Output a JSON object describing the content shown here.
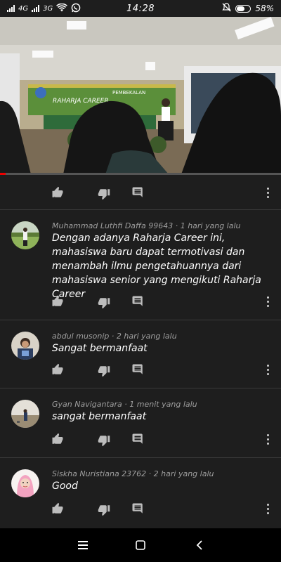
{
  "status_bar": {
    "net1": "4G",
    "net1_suffix": "ıl",
    "net2": "3G",
    "time": "14:28",
    "battery": "58%"
  },
  "video": {
    "banner_top": "PEMBEKALAN",
    "banner_name": "RAHARJA CAREER",
    "progress": 0.02
  },
  "video_actions": {
    "like_icon": "thumb-up-icon",
    "dislike_icon": "thumb-down-icon",
    "reply_icon": "comment-icon",
    "more_icon": "more-vert-icon"
  },
  "comments": [
    {
      "author": "Muhammad Luthfi Daffa 99643",
      "time": "1 hari yang lalu",
      "text": "Dengan adanya Raharja Career ini, mahasiswa baru dapat termotivasi dan menambah ilmu pengetahuannya dari mahasiswa senior yang mengikuti Raharja Career"
    },
    {
      "author": "abdul musonip",
      "time": "2 hari yang lalu",
      "text": "Sangat bermanfaat"
    },
    {
      "author": "Gyan Navigantara",
      "time": "1 menit yang lalu",
      "text": "sangat bermanfaat"
    },
    {
      "author": "Siskha Nuristiana 23762",
      "time": "2 hari yang lalu",
      "text": "Good"
    }
  ],
  "colors": {
    "background": "#1e1e1e",
    "divider": "#3a3a3a",
    "meta_text": "#9e9e9e",
    "progress": "#ee0000"
  }
}
